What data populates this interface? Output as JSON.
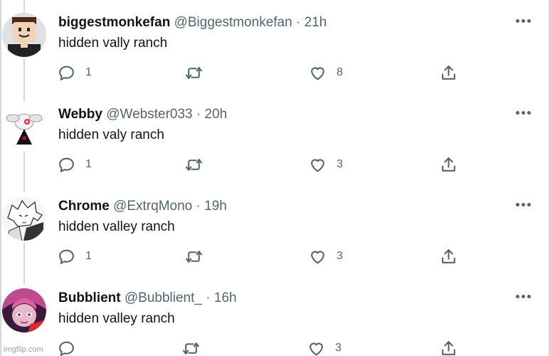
{
  "tweets": [
    {
      "name": "biggestmonkefan",
      "handle": "@Biggestmonkefan",
      "sep": "·",
      "time": "21h",
      "text": "hidden vally ranch",
      "replies": "1",
      "retweets": "",
      "likes": "8",
      "avatar": "roblox-avatar"
    },
    {
      "name": "Webby",
      "handle": "@Webster033",
      "sep": "·",
      "time": "20h",
      "text": "hidden valy ranch",
      "replies": "1",
      "retweets": "",
      "likes": "3",
      "avatar": "cartoon-creature-avatar"
    },
    {
      "name": "Chrome",
      "handle": "@ExtrqMono",
      "sep": "·",
      "time": "19h",
      "text": "hidden valley ranch",
      "replies": "1",
      "retweets": "",
      "likes": "3",
      "avatar": "manga-drawing-avatar"
    },
    {
      "name": "Bubblient",
      "handle": "@Bubblient_",
      "sep": "·",
      "time": "16h",
      "text": "hidden valley ranch",
      "replies": "",
      "retweets": "",
      "likes": "3",
      "avatar": "anime-character-avatar"
    }
  ],
  "watermark": "imgflip.com",
  "colors": {
    "text": "#0f1419",
    "muted": "#536471",
    "thread_line": "#cfd9de"
  }
}
